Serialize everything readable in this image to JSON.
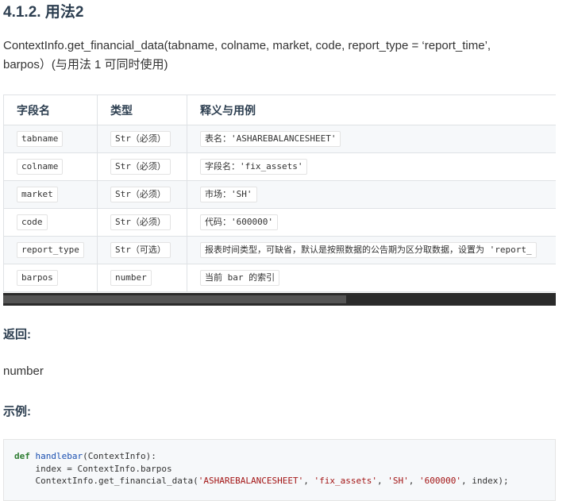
{
  "heading": "4.1.2. 用法2",
  "signature": {
    "line1": "ContextInfo.get_financial_data(tabname, colname, market, code, report_type = ‘report_time’,",
    "line2": "barpos）(与用法 1 可同时使用)"
  },
  "table": {
    "headers": [
      "字段名",
      "类型",
      "释义与用例"
    ],
    "rows": [
      {
        "field": "tabname",
        "type": "Str（必须）",
        "desc": "表名：'ASHAREBALANCESHEET'"
      },
      {
        "field": "colname",
        "type": "Str（必须）",
        "desc": "字段名：'fix_assets'"
      },
      {
        "field": "market",
        "type": "Str（必须）",
        "desc": "市场：'SH'"
      },
      {
        "field": "code",
        "type": "Str（必须）",
        "desc": "代码：'600000'"
      },
      {
        "field": "report_type",
        "type": "Str（可选）",
        "desc": "报表时间类型，可缺省，默认是按照数据的公告期为区分取数据，设置为 'report_"
      },
      {
        "field": "barpos",
        "type": "number",
        "desc": "当前 bar 的索引"
      }
    ]
  },
  "returns": {
    "label": "返回:",
    "value": "number"
  },
  "example": {
    "label": "示例:",
    "code": {
      "kw_def": "def",
      "fn_name": "handlebar",
      "line1_rest": "(ContextInfo):",
      "line2": "    index = ContextInfo.barpos",
      "line3_prefix": "    ContextInfo.get_financial_data(",
      "line3_s1": "'ASHAREBALANCESHEET'",
      "line3_s2": "'fix_assets'",
      "line3_s3": "'SH'",
      "line3_s4": "'600000'",
      "line3_sep": ", ",
      "line3_suffix": ", index);"
    }
  }
}
